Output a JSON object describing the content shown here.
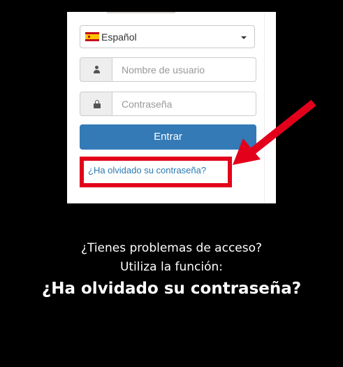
{
  "login_form": {
    "language": {
      "selected": "Español",
      "flag_icon": "spain-flag-icon",
      "dropdown_icon": "chevron-down-icon"
    },
    "username": {
      "placeholder": "Nombre de usuario",
      "icon": "user-icon"
    },
    "password": {
      "placeholder": "Contraseña",
      "icon": "lock-icon"
    },
    "submit_label": "Entrar",
    "forgot_link": "¿Ha olvidado su contraseña?"
  },
  "caption": {
    "line1": "¿Tienes problemas de acceso?",
    "line2": "Utiliza la función:",
    "line3": "¿Ha olvidado su contraseña?"
  },
  "colors": {
    "background": "#000000",
    "button": "#337ab7",
    "highlight": "#e3001b",
    "link": "#2a7ab0"
  }
}
